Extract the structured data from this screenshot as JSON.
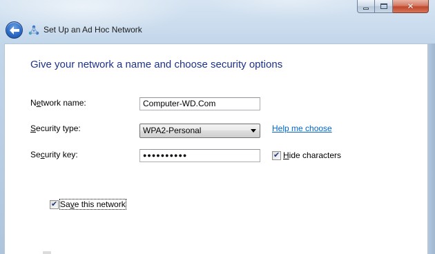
{
  "window": {
    "title": "Set Up an Ad Hoc Network",
    "back_button": "back-arrow-icon",
    "icon": "network-icon"
  },
  "caption_buttons": {
    "minimize": "minimize-icon",
    "maximize": "maximize-icon",
    "close": "close-icon"
  },
  "heading": "Give your network a name and choose security options",
  "form": {
    "network_name": {
      "label_pre": "N",
      "label_access": "e",
      "label_post": "twork name:",
      "value": "Computer-WD.Com"
    },
    "security_type": {
      "label_pre": "",
      "label_access": "S",
      "label_post": "ecurity type:",
      "selected": "WPA2-Personal",
      "help_link": "Help me choose"
    },
    "security_key": {
      "label_pre": "Se",
      "label_access": "c",
      "label_post": "urity key:",
      "value": "●●●●●●●●●●",
      "hide_characters": {
        "checked": true,
        "label_access": "H",
        "label_post": "ide characters"
      }
    },
    "save_network": {
      "checked": true,
      "label_pre": "Sa",
      "label_access": "v",
      "label_post": "e this network"
    }
  },
  "colors": {
    "heading": "#1e3287",
    "link": "#0066cc",
    "frame": "#bcd0e5"
  }
}
